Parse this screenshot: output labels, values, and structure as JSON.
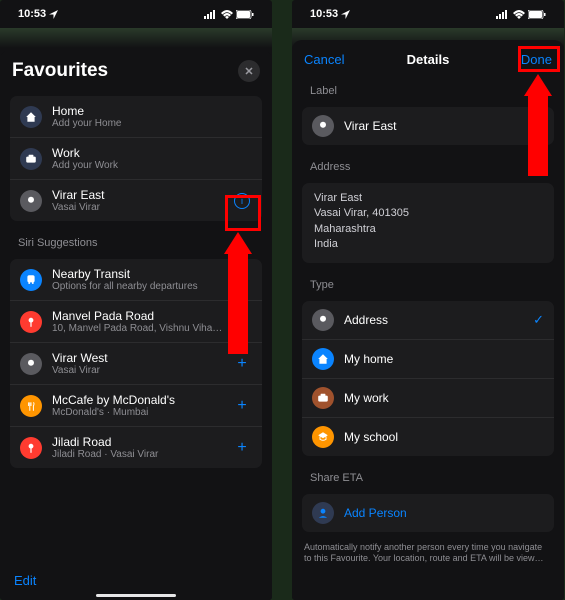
{
  "status": {
    "time": "10:53",
    "loc_icon": "location"
  },
  "left": {
    "title": "Favourites",
    "items": [
      {
        "icon": "home",
        "color": "#2f3a52",
        "title": "Home",
        "sub": "Add your Home",
        "action": null
      },
      {
        "icon": "work",
        "color": "#2f3a52",
        "title": "Work",
        "sub": "Add your Work",
        "action": null
      },
      {
        "icon": "pin",
        "color": "#5a5a5f",
        "title": "Virar East",
        "sub": "Vasai Virar",
        "action": "info"
      }
    ],
    "suggestions_label": "Siri Suggestions",
    "suggestions": [
      {
        "icon": "transit",
        "color": "#0a84ff",
        "title": "Nearby Transit",
        "sub": "Options for all nearby departures",
        "action": null
      },
      {
        "icon": "pin",
        "color": "#ff3b30",
        "title": "Manvel Pada Road",
        "sub": "10, Manvel Pada Road, Vishnu Viha…",
        "action": null
      },
      {
        "icon": "pin",
        "color": "#5a5a5f",
        "title": "Virar West",
        "sub": "Vasai Virar",
        "action": "add"
      },
      {
        "icon": "food",
        "color": "#ff9500",
        "title": "McCafe by McDonald's",
        "sub": "McDonald's · Mumbai",
        "action": "add"
      },
      {
        "icon": "pin",
        "color": "#ff3b30",
        "title": "Jiladi Road",
        "sub": "Jiladi Road · Vasai Virar",
        "action": "add"
      }
    ],
    "edit": "Edit"
  },
  "right": {
    "cancel": "Cancel",
    "title": "Details",
    "done": "Done",
    "label_section": "Label",
    "label_value": "Virar East",
    "address_section": "Address",
    "address": [
      "Virar East",
      "Vasai Virar, 401305",
      "Maharashtra",
      "India"
    ],
    "type_section": "Type",
    "types": [
      {
        "icon": "pin",
        "color": "#5a5a5f",
        "title": "Address",
        "checked": true
      },
      {
        "icon": "home",
        "color": "#0a84ff",
        "title": "My home",
        "checked": false
      },
      {
        "icon": "work",
        "color": "#a0522d",
        "title": "My work",
        "checked": false
      },
      {
        "icon": "school",
        "color": "#ff9500",
        "title": "My school",
        "checked": false
      }
    ],
    "share_section": "Share ETA",
    "add_person": "Add Person",
    "share_desc": "Automatically notify another person every time you navigate to this Favourite. Your location, route and ETA will be view…"
  }
}
